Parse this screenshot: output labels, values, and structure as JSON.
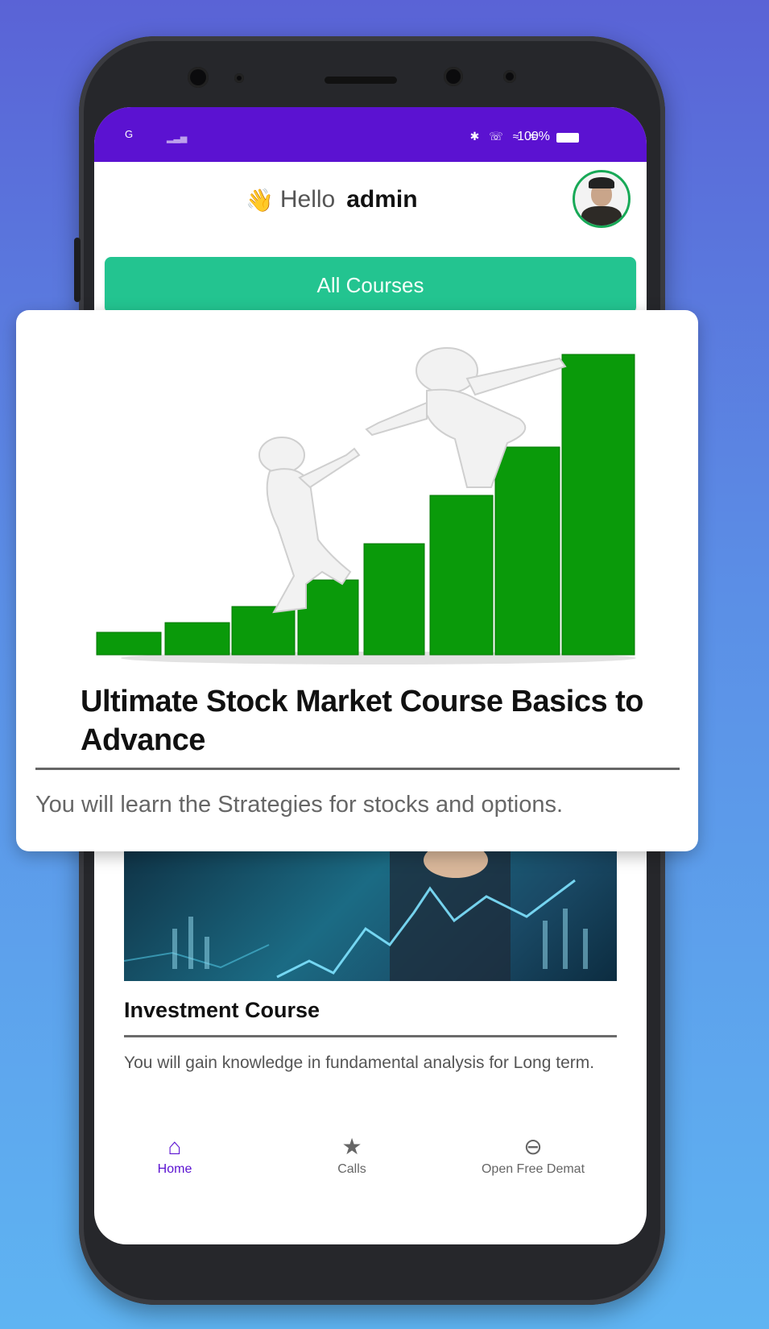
{
  "status_bar": {
    "signal": "G",
    "icons": "✱ ☏ ≈ ᯤ",
    "battery": "100%"
  },
  "header": {
    "greeting": "Hello",
    "username": "admin",
    "wave_icon": "👋"
  },
  "all_courses_label": "All Courses",
  "featured_course": {
    "title": "Ultimate Stock Market Course Basics to Advance",
    "description": "You will learn the Strategies for stocks and options."
  },
  "second_course": {
    "title": "Investment Course",
    "description": "You will gain knowledge in fundamental analysis for Long term."
  },
  "bottom_nav": [
    {
      "label": "Home",
      "icon": "home-icon",
      "glyph": "⌂",
      "active": true
    },
    {
      "label": "Calls",
      "icon": "star-icon",
      "glyph": "★",
      "active": false
    },
    {
      "label": "Open Free Demat",
      "icon": "link-icon",
      "glyph": "⊖",
      "active": false
    }
  ],
  "colors": {
    "status_bar": "#5b12d1",
    "primary_button": "#23c490",
    "active_nav": "#5b12d1",
    "avatar_ring": "#18a957",
    "bars": "#0a9a0a"
  }
}
